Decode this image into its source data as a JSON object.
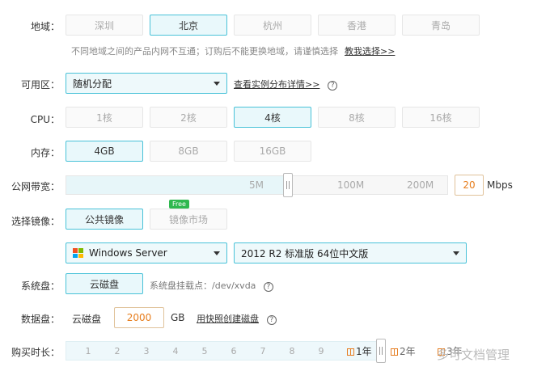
{
  "region": {
    "label": "地域：",
    "options": [
      "深圳",
      "北京",
      "杭州",
      "香港",
      "青岛"
    ],
    "selected": "北京",
    "note": "不同地域之间的产品内网不互通；订购后不能更换地域，请谨慎选择",
    "help_link": "教我选择>>"
  },
  "zone": {
    "label": "可用区：",
    "value": "随机分配",
    "link": "查看实例分布详情>>",
    "help_glyph": "?"
  },
  "cpu": {
    "label": "CPU：",
    "options": [
      "1核",
      "2核",
      "4核",
      "8核",
      "16核"
    ],
    "selected": "4核"
  },
  "memory": {
    "label": "内存：",
    "options": [
      "4GB",
      "8GB",
      "16GB"
    ],
    "selected": "4GB"
  },
  "bandwidth": {
    "label": "公网带宽：",
    "marks": [
      "5M",
      "100M",
      "200M"
    ],
    "value": "20",
    "unit": "Mbps"
  },
  "image": {
    "label": "选择镜像：",
    "tabs": [
      "公共镜像",
      "镜像市场"
    ],
    "selected": "公共镜像",
    "badge": "Free",
    "os": "Windows Server",
    "version": "2012 R2 标准版 64位中文版"
  },
  "system_disk": {
    "label": "系统盘：",
    "type": "云磁盘",
    "mount_note": "系统盘挂载点：/dev/xvda",
    "help_glyph": "?"
  },
  "data_disk": {
    "label": "数据盘：",
    "type": "云磁盘",
    "size": "2000",
    "unit": "GB",
    "snapshot_link": "用快照创建磁盘",
    "help_glyph": "?"
  },
  "duration": {
    "label": "购买时长：",
    "months": [
      "1",
      "2",
      "3",
      "4",
      "5",
      "6",
      "7",
      "8",
      "9"
    ],
    "years": [
      "1年",
      "2年",
      "3年"
    ],
    "selected": "1年"
  },
  "watermark": "多可文档管理",
  "colors": {
    "accent": "#49c2d8",
    "selected_bg": "#e9f8fb",
    "free_badge": "#2fb84f",
    "bandwidth_value": "#e77d1c",
    "windows_logo": [
      "#f25022",
      "#7fba00",
      "#00a4ef",
      "#ffb900"
    ]
  },
  "icons": [
    "help-circle-icon",
    "caret-down-icon",
    "windows-logo-icon",
    "gift-icon",
    "slider-handle-icon"
  ]
}
